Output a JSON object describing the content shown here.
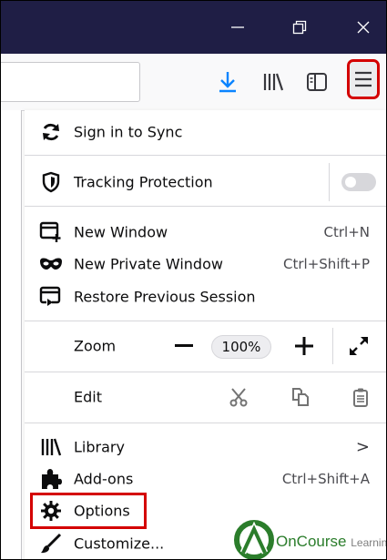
{
  "window_controls": {
    "minimize_icon": "minimize-icon",
    "restore_icon": "restore-icon",
    "close_icon": "close-icon"
  },
  "toolbar": {
    "icons": [
      "download-icon",
      "library-icon",
      "sidebar-icon",
      "hamburger-menu-icon"
    ],
    "download_color": "#0a84ff",
    "menu_highlight_color": "#d40000"
  },
  "menu": {
    "sign_in": "Sign in to Sync",
    "tracking_protection": "Tracking Protection",
    "tracking_toggle_on": false,
    "new_window": "New Window",
    "new_window_shortcut": "Ctrl+N",
    "new_private_window": "New Private Window",
    "new_private_window_shortcut": "Ctrl+Shift+P",
    "restore_session": "Restore Previous Session",
    "zoom_label": "Zoom",
    "zoom_minus": "—",
    "zoom_value": "100%",
    "zoom_plus": "+",
    "edit_label": "Edit",
    "library": "Library",
    "library_chevron": ">",
    "addons": "Add-ons",
    "addons_shortcut": "Ctrl+Shift+A",
    "options": "Options",
    "customize": "Customize..."
  },
  "watermark": {
    "brand": "OnCourse",
    "brand_sub": "Learning",
    "color": "#2b7d2b"
  }
}
